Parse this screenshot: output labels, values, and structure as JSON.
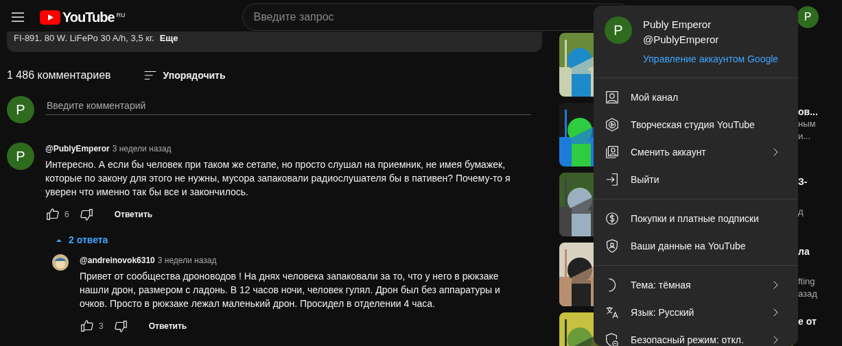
{
  "header": {
    "logo_text": "YouTube",
    "region": "RU",
    "search": {
      "placeholder": "Введите запрос"
    },
    "avatar_letter": "P"
  },
  "description": {
    "text": "FI-891. 80 W. LiFePo 30 A/h, 3,5 кг.",
    "more": "Еще"
  },
  "comments_header": {
    "count": "1 486 комментариев",
    "sort_label": "Упорядочить"
  },
  "new_comment": {
    "avatar_letter": "P",
    "placeholder": "Введите комментарий"
  },
  "comments": [
    {
      "kind": "letter",
      "avatar_letter": "P",
      "author": "@PublyEmperor",
      "time": "3 недели назад",
      "text": "Интересно. А если бы человек при таком же сетапе, но просто слушал на приемник, не имея бумажек, которые по закону для этого не нужны, мусора запаковали радиослушателя бы в пативен? Почему-то я уверен что именно так бы все и закончилось.",
      "likes": "6",
      "reply_label": "Ответить",
      "replies_toggle": {
        "label": "2 ответа",
        "expanded": true
      },
      "replies": [
        {
          "kind": "cartoon",
          "author": "@andreinovok6310",
          "time": "3 недели назад",
          "text": "Привет от сообщества дроноводов ! На днях человека запаковали за то, что у него в рюкзаке нашли дрон, размером с ладонь. В 12 часов ночи, человек гулял. Дрон был без аппаратуры и очков. Просто в рюкзаке лежал маленький дрон. Просидел в отделении 4 часа.",
          "likes": "3",
          "reply_label": "Ответить"
        }
      ]
    }
  ],
  "related_videos": [
    {
      "kind": "picture"
    },
    {
      "kind": "picture",
      "fragments": [
        {
          "kind": "title",
          "text": "ов..."
        },
        {
          "kind": "meta",
          "text": "ным"
        },
        {
          "kind": "meta",
          "text": "и..."
        }
      ]
    },
    {
      "kind": "picture",
      "fragments": [
        {
          "kind": "title",
          "text": "З-"
        },
        {
          "kind": "meta_low",
          "text": "д"
        }
      ]
    },
    {
      "kind": "picture",
      "fragments": [
        {
          "kind": "title",
          "text": "ла"
        },
        {
          "kind": "meta_low",
          "text": "fting"
        },
        {
          "kind": "meta",
          "text": "азад"
        }
      ]
    },
    {
      "kind": "picture",
      "fragments": [
        {
          "kind": "title",
          "text": "е от"
        }
      ]
    }
  ],
  "account_menu": {
    "avatar_letter": "P",
    "name": "Publy Emperor",
    "handle": "@PublyEmperor",
    "manage_link": "Управление аккаунтом Google",
    "sections": [
      [
        {
          "label": "Мой канал",
          "submenu": false
        },
        {
          "label": "Творческая студия YouTube",
          "submenu": false
        },
        {
          "label": "Сменить аккаунт",
          "submenu": true
        },
        {
          "label": "Выйти",
          "submenu": false
        }
      ],
      [
        {
          "label": "Покупки и платные подписки",
          "submenu": false
        },
        {
          "label": "Ваши данные на YouTube",
          "submenu": false
        }
      ],
      [
        {
          "label": "Тема: тёмная",
          "submenu": true
        },
        {
          "label": "Язык: Русский",
          "submenu": true
        },
        {
          "label": "Безопасный режим: откл.",
          "submenu": true
        }
      ]
    ]
  }
}
